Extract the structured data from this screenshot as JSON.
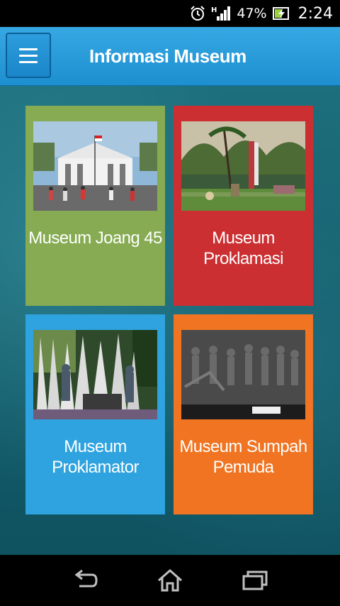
{
  "status_bar": {
    "battery_percent": "47%",
    "time": "2:24",
    "network_type": "H",
    "icons": [
      "alarm-icon",
      "signal-icon",
      "battery-charging-icon"
    ]
  },
  "app_bar": {
    "title": "Informasi Museum",
    "menu_icon": "hamburger-menu-icon"
  },
  "museums": [
    {
      "label": "Museum Joang 45",
      "color": "#86ab52"
    },
    {
      "label": "Museum Proklamasi",
      "color": "#cb2f32"
    },
    {
      "label": "Museum Proklamator",
      "color": "#2ea3df"
    },
    {
      "label": "Museum Sumpah Pemuda",
      "color": "#f07421"
    }
  ],
  "nav_bar": {
    "icons": [
      "back-icon",
      "home-icon",
      "recent-apps-icon"
    ]
  }
}
